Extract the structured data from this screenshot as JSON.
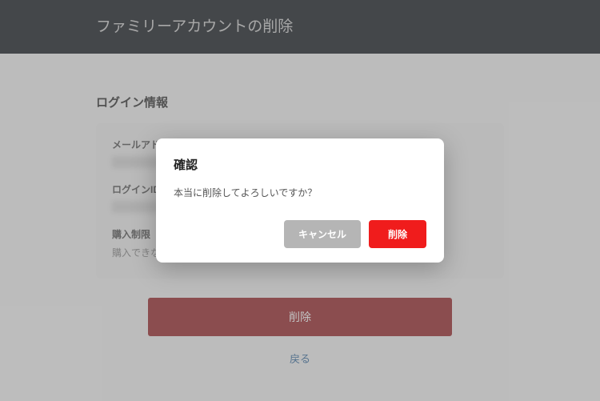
{
  "header": {
    "title": "ファミリーアカウントの削除"
  },
  "section": {
    "title": "ログイン情報"
  },
  "fields": {
    "email_label": "メールアドレス",
    "login_id_label": "ログインID",
    "purchase_limit_label": "購入制限",
    "purchase_limit_note": "購入できないように"
  },
  "actions": {
    "delete_bar": "削除",
    "back_link": "戻る"
  },
  "modal": {
    "title": "確認",
    "message": "本当に削除してよろしいですか？",
    "cancel_label": "キャンセル",
    "delete_label": "削除"
  }
}
